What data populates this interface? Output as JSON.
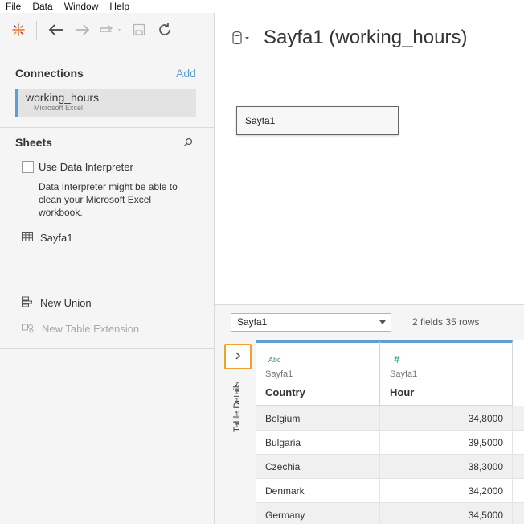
{
  "menu": [
    "File",
    "Data",
    "Window",
    "Help"
  ],
  "connections": {
    "header": "Connections",
    "add_label": "Add",
    "item_name": "working_hours",
    "item_type": "Microsoft Excel"
  },
  "sheets": {
    "header": "Sheets",
    "use_interpreter_label": "Use Data Interpreter",
    "interpreter_desc": "Data Interpreter might be able to clean your Microsoft Excel workbook.",
    "items": [
      "Sayfa1"
    ],
    "new_union": "New Union",
    "new_table_extension": "New Table Extension"
  },
  "datasource": {
    "title": "Sayfa1 (working_hours)",
    "canvas_sheet": "Sayfa1"
  },
  "grid": {
    "selected_table": "Sayfa1",
    "stats": "2 fields 35 rows",
    "details_label": "Table Details",
    "columns": [
      {
        "type": "Abc",
        "source": "Sayfa1",
        "name": "Country"
      },
      {
        "type": "#",
        "source": "Sayfa1",
        "name": "Hour"
      }
    ],
    "rows": [
      {
        "country": "Belgium",
        "hour": "34,8000"
      },
      {
        "country": "Bulgaria",
        "hour": "39,5000"
      },
      {
        "country": "Czechia",
        "hour": "38,3000"
      },
      {
        "country": "Denmark",
        "hour": "34,2000"
      },
      {
        "country": "Germany",
        "hour": "34,5000"
      }
    ]
  },
  "colors": {
    "accent": "#5b9fd5",
    "highlight": "#f3a12e",
    "number_type": "#3aa76d"
  }
}
